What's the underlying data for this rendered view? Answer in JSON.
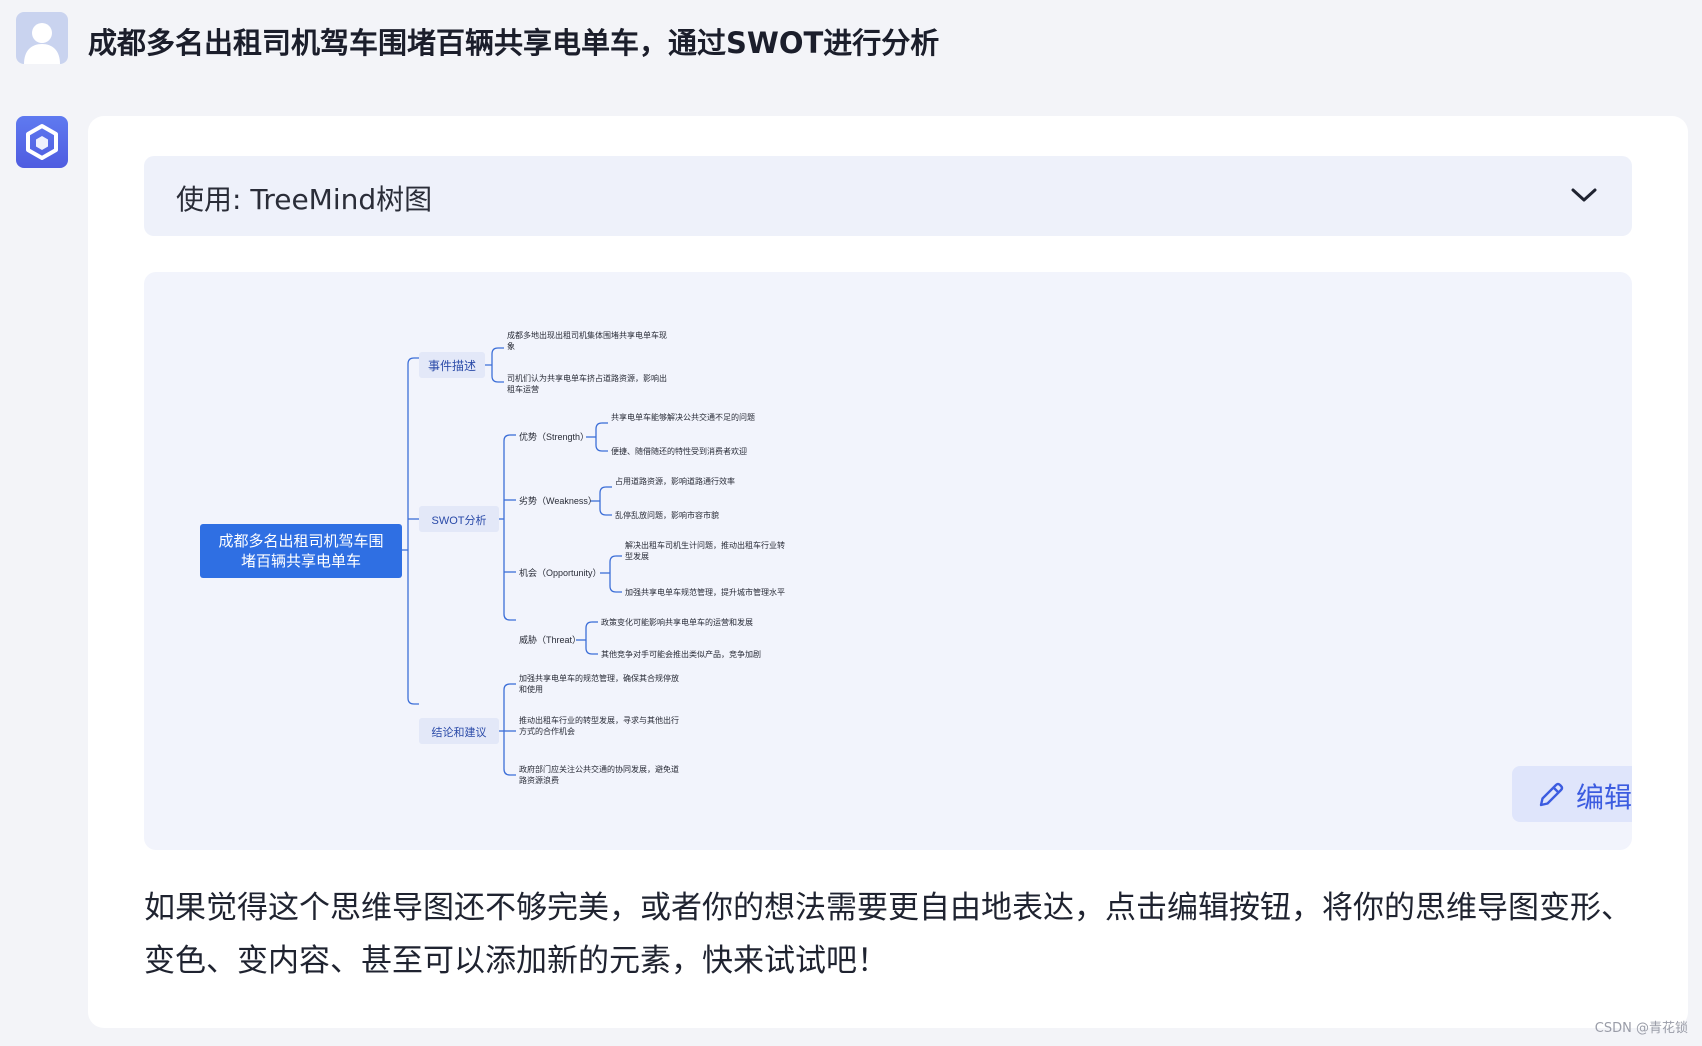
{
  "question": "成都多名出租司机驾车围堵百辆共享电单车，通过SWOT进行分析",
  "tool": {
    "label": "使用: TreeMind树图"
  },
  "mindmap": {
    "root": {
      "line1": "成都多名出租司机驾车围",
      "line2": "堵百辆共享电单车"
    },
    "branches": {
      "event": {
        "label": "事件描述",
        "items": [
          {
            "line1": "成都多地出现出租司机集体围堵共享电单车现",
            "line2": "象"
          },
          {
            "line1": "司机们认为共享电单车挤占道路资源，影响出",
            "line2": "租车运营"
          }
        ]
      },
      "swot": {
        "label": "SWOT分析",
        "strength": {
          "label": "优势（Strength）",
          "items": [
            "共享电单车能够解决公共交通不足的问题",
            "便捷、随借随还的特性受到消费者欢迎"
          ]
        },
        "weakness": {
          "label": "劣势（Weakness）",
          "items": [
            "占用道路资源，影响道路通行效率",
            "乱停乱放问题，影响市容市貌"
          ]
        },
        "opportunity": {
          "label": "机会（Opportunity）",
          "items": [
            {
              "line1": "解决出租车司机生计问题，推动出租车行业转",
              "line2": "型发展"
            },
            "加强共享电单车规范管理，提升城市管理水平"
          ]
        },
        "threat": {
          "label": "威胁（Threat）",
          "items": [
            "政策变化可能影响共享电单车的运营和发展",
            "其他竞争对手可能会推出类似产品，竞争加剧"
          ]
        }
      },
      "conclusion": {
        "label": "结论和建议",
        "items": [
          {
            "line1": "加强共享电单车的规范管理，确保其合规停放",
            "line2": "和使用"
          },
          {
            "line1": "推动出租车行业的转型发展，寻求与其他出行",
            "line2": "方式的合作机会"
          },
          {
            "line1": "政府部门应关注公共交通的协同发展，避免道",
            "line2": "路资源浪费"
          }
        ]
      }
    }
  },
  "edit_button": {
    "label": "编辑"
  },
  "footer": "如果觉得这个思维导图还不够完美，或者你的想法需要更自由地表达，点击编辑按钮，将你的思维导图变形、变色、变内容、甚至可以添加新的元素，快来试试吧！",
  "watermark": "CSDN @青花锁",
  "colors": {
    "accent": "#3c5ce0",
    "root_node": "#2f6fe3",
    "branch_bg": "#e3e8f8",
    "line": "#3d6fd8"
  }
}
